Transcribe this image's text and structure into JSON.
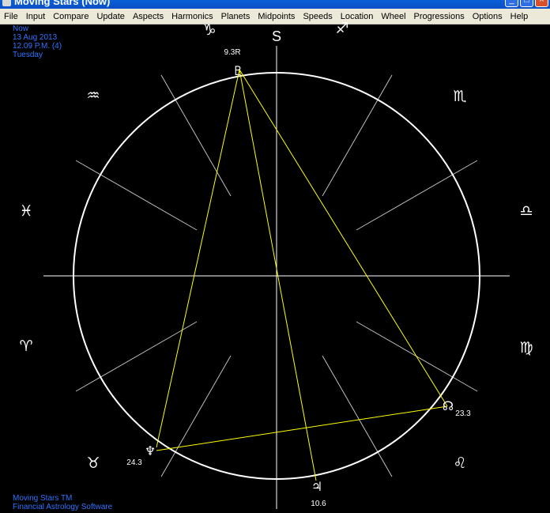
{
  "window": {
    "title": "Moving Stars (Now)"
  },
  "menu": {
    "items": [
      "File",
      "Input",
      "Compare",
      "Update",
      "Aspects",
      "Harmonics",
      "Planets",
      "Midpoints",
      "Speeds",
      "Location",
      "Wheel",
      "Progressions",
      "Options",
      "Help"
    ]
  },
  "info": {
    "label": "Now",
    "date": "13 Aug 2013",
    "time": "12.09 P.M. (4)",
    "weekday": "Tuesday"
  },
  "footer": {
    "line1": "Moving Stars TM",
    "line2": "Financial Astrology Software"
  },
  "wheel": {
    "axis_label": "S",
    "signs": {
      "aquarius": "♒",
      "pisces": "♓",
      "aries": "♈",
      "taurus": "♉",
      "scorpio": "♏",
      "libra": "♎",
      "virgo": "♍",
      "leo": "♌",
      "capricorn": "♑",
      "sagittarius": "♐"
    },
    "planets": {
      "pluto": {
        "glyph": "♇",
        "position": "9.3R"
      },
      "neptune": {
        "glyph": "♆",
        "position": "24.3"
      },
      "jupiter": {
        "glyph": "♃",
        "position": "10.6"
      },
      "node": {
        "glyph": "☊",
        "position": "23.3"
      }
    },
    "colors": {
      "circle": "#ffffff",
      "aspect_line": "#ffff00",
      "spoke": "#c0c0c0",
      "info_text": "#2f74ff"
    }
  }
}
